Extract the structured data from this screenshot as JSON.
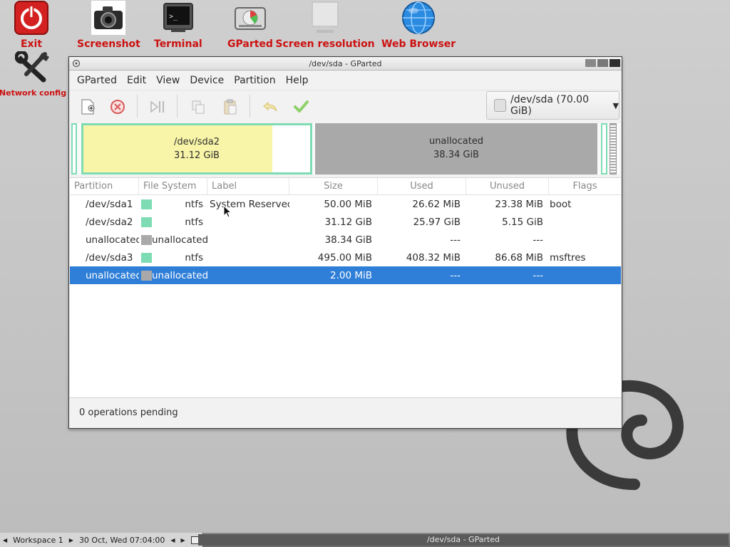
{
  "desktop": {
    "icons": [
      {
        "label": "Exit"
      },
      {
        "label": "Screenshot"
      },
      {
        "label": "Terminal"
      },
      {
        "label": "GParted"
      },
      {
        "label": "Screen resolution"
      },
      {
        "label": "Web Browser"
      },
      {
        "label": "Network config"
      }
    ]
  },
  "window": {
    "title": "/dev/sda - GParted",
    "menu": [
      "GParted",
      "Edit",
      "View",
      "Device",
      "Partition",
      "Help"
    ],
    "toolbar": {
      "buttons": [
        "new-icon",
        "delete-icon",
        "resize-move-icon",
        "copy-icon",
        "paste-icon",
        "undo-icon",
        "apply-icon"
      ],
      "device_selector": "/dev/sda (70.00 GiB)"
    },
    "graph": {
      "partitions": [
        {
          "name": "/dev/sda2",
          "size": "31.12 GiB",
          "used_fraction": 0.834
        },
        {
          "name": "unallocated",
          "size": "38.34 GiB"
        }
      ]
    },
    "table": {
      "headers": [
        "Partition",
        "File System",
        "Label",
        "Size",
        "Used",
        "Unused",
        "Flags"
      ],
      "rows": [
        {
          "partition": "/dev/sda1",
          "fs": "ntfs",
          "fs_color": "#7ddcb4",
          "label": "System Reserved",
          "size": "50.00 MiB",
          "used": "26.62 MiB",
          "unused": "23.38 MiB",
          "flags": "boot"
        },
        {
          "partition": "/dev/sda2",
          "fs": "ntfs",
          "fs_color": "#7ddcb4",
          "label": "",
          "size": "31.12 GiB",
          "used": "25.97 GiB",
          "unused": "5.15 GiB",
          "flags": ""
        },
        {
          "partition": "unallocated",
          "fs": "unallocated",
          "fs_color": "#a9a9a9",
          "label": "",
          "size": "38.34 GiB",
          "used": "---",
          "unused": "---",
          "flags": ""
        },
        {
          "partition": "/dev/sda3",
          "fs": "ntfs",
          "fs_color": "#7ddcb4",
          "label": "",
          "size": "495.00 MiB",
          "used": "408.32 MiB",
          "unused": "86.68 MiB",
          "flags": "msftres"
        },
        {
          "partition": "unallocated",
          "fs": "unallocated",
          "fs_color": "#a9a9a9",
          "label": "",
          "size": "2.00 MiB",
          "used": "---",
          "unused": "---",
          "flags": "",
          "selected": true
        }
      ]
    },
    "status": "0 operations pending"
  },
  "taskbar": {
    "workspace": "Workspace 1",
    "clock": "30 Oct, Wed 07:04:00",
    "task": "/dev/sda - GParted"
  },
  "colors": {
    "accent_selection": "#2f7fd8",
    "fs_ntfs": "#7ddcb4",
    "unallocated": "#a9a9a9",
    "used_fill": "#f8f4a8",
    "icon_label": "#cc1111"
  }
}
